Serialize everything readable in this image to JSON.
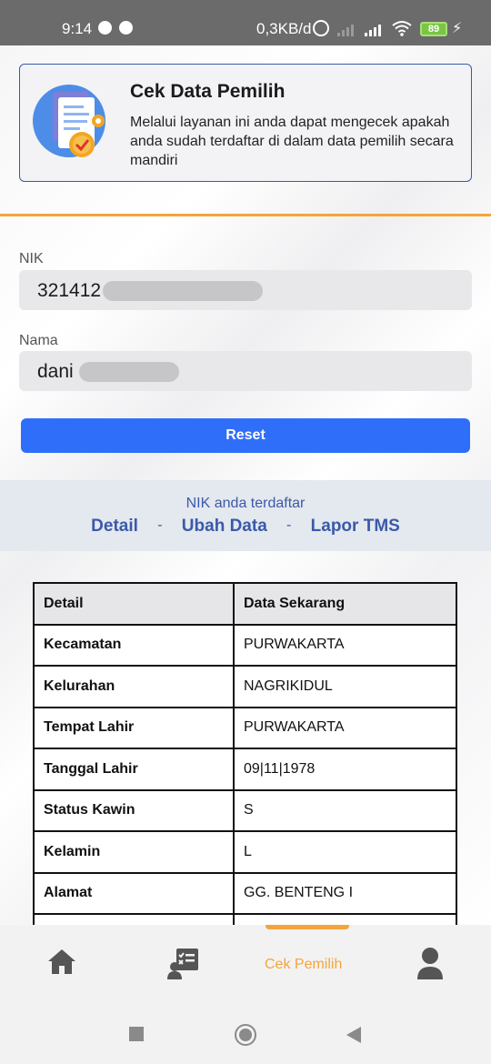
{
  "status_bar": {
    "time": "9:14",
    "network_speed": "0,3KB/d",
    "battery": "89"
  },
  "info_card": {
    "title": "Cek Data Pemilih",
    "description": "Melalui layanan ini anda dapat mengecek apakah anda sudah terdaftar di dalam data pemilih secara mandiri"
  },
  "form": {
    "nik_label": "NIK",
    "nik_value": "321412",
    "nama_label": "Nama",
    "nama_value": "dani",
    "reset_label": "Reset"
  },
  "result": {
    "message": "NIK anda terdaftar",
    "links": [
      "Detail",
      "Ubah Data",
      "Lapor TMS"
    ],
    "separator": "-"
  },
  "table": {
    "headers": [
      "Detail",
      "Data Sekarang"
    ],
    "rows": [
      [
        "Kecamatan",
        "PURWAKARTA"
      ],
      [
        "Kelurahan",
        "NAGRIKIDUL"
      ],
      [
        "Tempat Lahir",
        "PURWAKARTA"
      ],
      [
        "Tanggal Lahir",
        "09|11|1978"
      ],
      [
        "Status Kawin",
        "S"
      ],
      [
        "Kelamin",
        "L"
      ],
      [
        "Alamat",
        "GG. BENTENG I"
      ]
    ]
  },
  "bottom_nav": {
    "items": [
      {
        "icon": "home-icon"
      },
      {
        "icon": "checklist-icon"
      },
      {
        "label": "Cek Pemilih",
        "active": true
      },
      {
        "icon": "user-icon"
      }
    ],
    "active_color": "#f4a53a"
  },
  "colors": {
    "primary": "#2f6ef8",
    "accent": "#f4a53a",
    "link": "#3a5aa8"
  }
}
